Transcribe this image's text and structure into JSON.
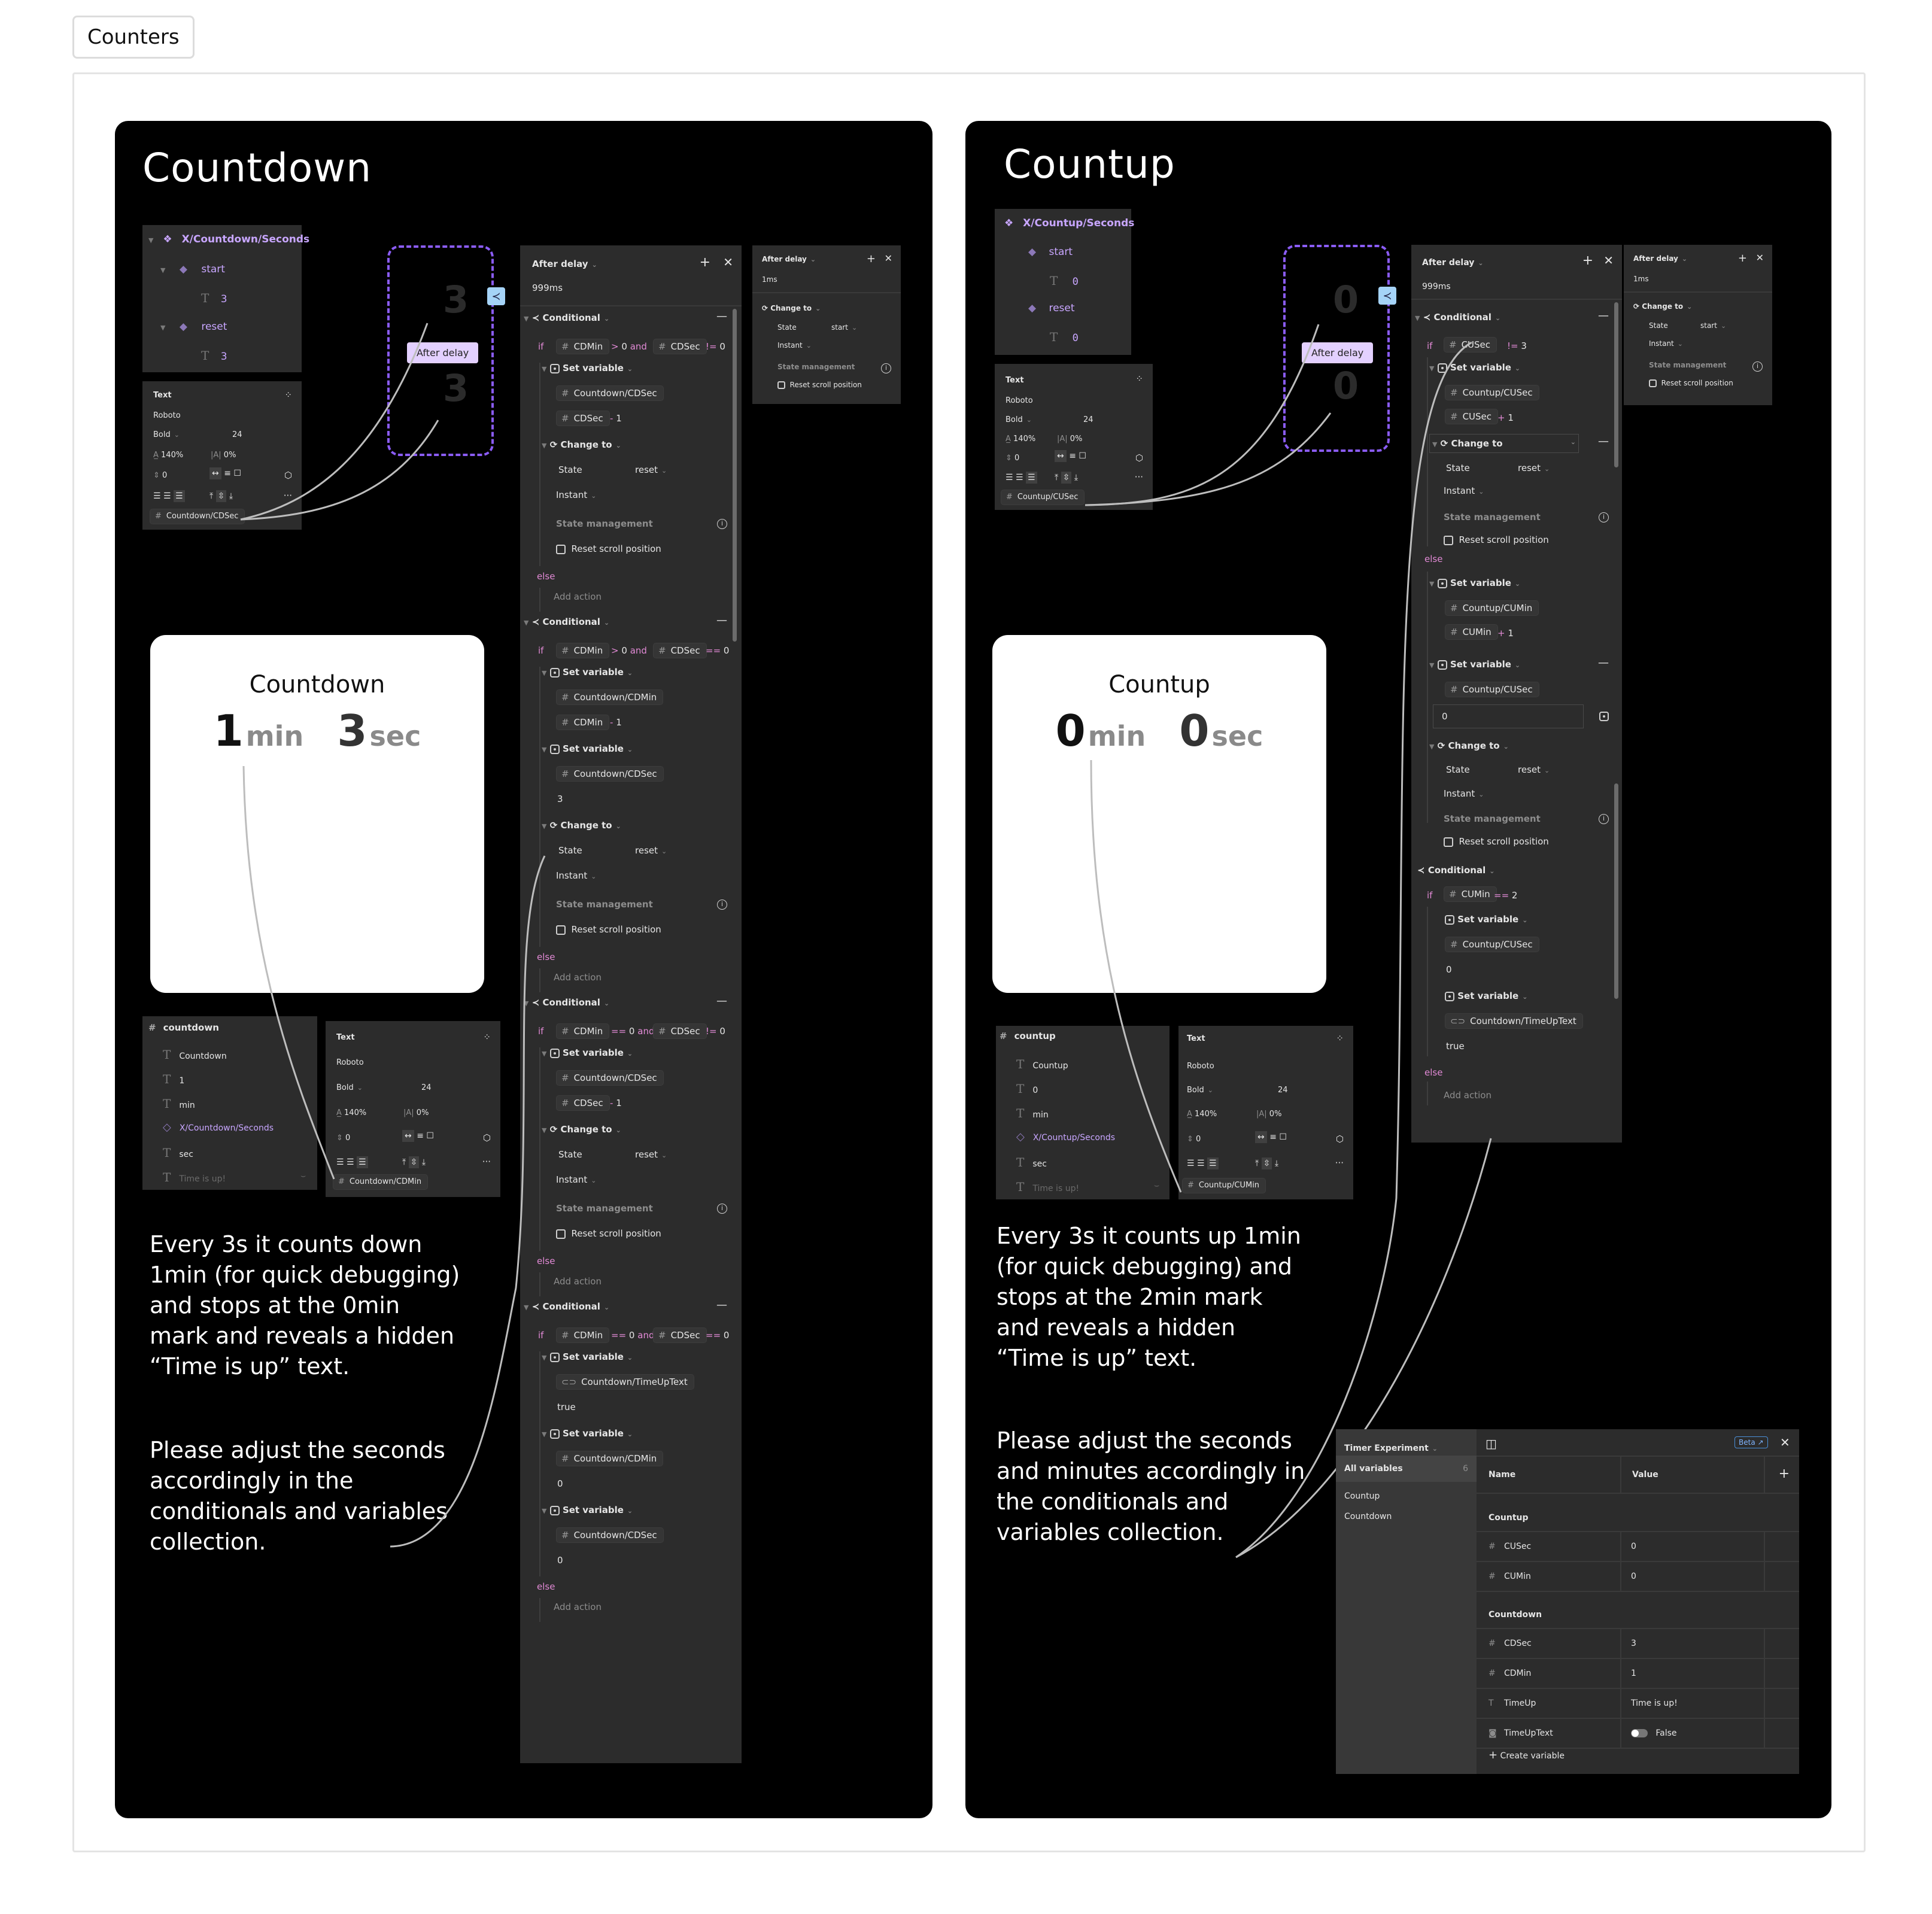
{
  "page_tab": "Counters",
  "countdown": {
    "title": "Countdown",
    "component_tree": {
      "name": "X/Countdown/Seconds",
      "variants": [
        {
          "name": "start",
          "text": "3"
        },
        {
          "name": "reset",
          "text": "3"
        }
      ]
    },
    "text_panel": {
      "title": "Text",
      "font": "Roboto",
      "weight": "Bold",
      "size": "24",
      "line_height": "140%",
      "letter_spacing": "0%",
      "paragraph_spacing": "0",
      "bound_variable": "Countdown/CDSec"
    },
    "variant_preview": {
      "top_num": "3",
      "bottom_num": "3",
      "trigger_label": "After delay"
    },
    "main_interaction": {
      "trigger": "After delay",
      "delay": "999ms",
      "conditionals": [
        {
          "label": "Conditional",
          "if": {
            "left_var": "CDMin",
            "left_op": ">",
            "left_val": "0",
            "join": "and",
            "right_var": "CDSec",
            "right_op": "!=",
            "right_val": "0"
          },
          "actions": [
            {
              "type": "Set variable",
              "target": "Countdown/CDSec",
              "expr_var": "CDSec",
              "expr_op": "-",
              "expr_val": "1"
            },
            {
              "type": "Change to",
              "state_label": "State",
              "state": "reset",
              "transition": "Instant",
              "state_mgmt": "State management",
              "reset_scroll": "Reset scroll position"
            }
          ],
          "else_label": "else",
          "else_action": "Add action"
        },
        {
          "label": "Conditional",
          "if": {
            "left_var": "CDMin",
            "left_op": ">",
            "left_val": "0",
            "join": "and",
            "right_var": "CDSec",
            "right_op": "==",
            "right_val": "0"
          },
          "actions": [
            {
              "type": "Set variable",
              "target": "Countdown/CDMin",
              "expr_var": "CDMin",
              "expr_op": "-",
              "expr_val": "1"
            },
            {
              "type": "Set variable",
              "target": "Countdown/CDSec",
              "value": "3"
            },
            {
              "type": "Change to",
              "state_label": "State",
              "state": "reset",
              "transition": "Instant",
              "state_mgmt": "State management",
              "reset_scroll": "Reset scroll position"
            }
          ],
          "else_label": "else",
          "else_action": "Add action"
        },
        {
          "label": "Conditional",
          "if": {
            "left_var": "CDMin",
            "left_op": "==",
            "left_val": "0",
            "join": "and",
            "right_var": "CDSec",
            "right_op": "!=",
            "right_val": "0"
          },
          "actions": [
            {
              "type": "Set variable",
              "target": "Countdown/CDSec",
              "expr_var": "CDSec",
              "expr_op": "-",
              "expr_val": "1"
            },
            {
              "type": "Change to",
              "state_label": "State",
              "state": "reset",
              "transition": "Instant",
              "state_mgmt": "State management",
              "reset_scroll": "Reset scroll position"
            }
          ],
          "else_label": "else",
          "else_action": "Add action"
        },
        {
          "label": "Conditional",
          "if": {
            "left_var": "CDMin",
            "left_op": "==",
            "left_val": "0",
            "join": "and",
            "right_var": "CDSec",
            "right_op": "==",
            "right_val": "0"
          },
          "actions": [
            {
              "type": "Set variable",
              "target": "Countdown/TimeUpText",
              "value": "true"
            },
            {
              "type": "Set variable",
              "target": "Countdown/CDMin",
              "value": "0"
            },
            {
              "type": "Set variable",
              "target": "Countdown/CDSec",
              "value": "0"
            }
          ],
          "else_label": "else",
          "else_action": "Add action"
        }
      ]
    },
    "reset_interaction": {
      "trigger": "After delay",
      "delay": "1ms",
      "action": "Change to",
      "state_label": "State",
      "state": "start",
      "transition": "Instant",
      "state_mgmt": "State management",
      "reset_scroll": "Reset scroll position"
    },
    "preview": {
      "title": "Countdown",
      "min_value": "1",
      "min_unit": "min",
      "sec_value": "3",
      "sec_unit": "sec"
    },
    "layers": {
      "frame": "countdown",
      "items": [
        {
          "icon": "text",
          "label": "Countdown"
        },
        {
          "icon": "text",
          "label": "1"
        },
        {
          "icon": "text",
          "label": "min"
        },
        {
          "icon": "instance",
          "label": "X/Countdown/Seconds"
        },
        {
          "icon": "text",
          "label": "sec"
        },
        {
          "icon": "text",
          "label": "Time is up!",
          "hidden": true
        }
      ]
    },
    "text_panel_2": {
      "title": "Text",
      "font": "Roboto",
      "weight": "Bold",
      "size": "24",
      "line_height": "140%",
      "letter_spacing": "0%",
      "paragraph_spacing": "0",
      "bound_variable": "Countdown/CDMin"
    },
    "description": [
      "Every 3s it counts down 1min (for quick debugging) and stops at the 0min mark and reveals a hidden “Time is up” text.",
      "Please adjust the seconds accordingly in the conditionals and variables collection."
    ]
  },
  "countup": {
    "title": "Countup",
    "component_tree": {
      "name": "X/Countup/Seconds",
      "variants": [
        {
          "name": "start",
          "text": "0"
        },
        {
          "name": "reset",
          "text": "0"
        }
      ]
    },
    "text_panel": {
      "title": "Text",
      "font": "Roboto",
      "weight": "Bold",
      "size": "24",
      "line_height": "140%",
      "letter_spacing": "0%",
      "paragraph_spacing": "0",
      "bound_variable": "Countup/CUSec"
    },
    "variant_preview": {
      "top_num": "0",
      "bottom_num": "0",
      "trigger_label": "After delay"
    },
    "main_interaction": {
      "trigger": "After delay",
      "delay": "999ms",
      "cond1": {
        "label": "Conditional",
        "if_var": "CUSec",
        "if_op": "!=",
        "if_val": "3",
        "set1": {
          "type": "Set variable",
          "target": "Countup/CUSec",
          "expr_var": "CUSec",
          "expr_op": "+",
          "expr_val": "1"
        },
        "change": {
          "type": "Change to",
          "state_label": "State",
          "state": "reset",
          "transition": "Instant",
          "state_mgmt": "State management",
          "reset_scroll": "Reset scroll position"
        },
        "else_label": "else",
        "else_set1": {
          "type": "Set variable",
          "target": "Countup/CUMin",
          "expr_var": "CUMin",
          "expr_op": "+",
          "expr_val": "1"
        },
        "else_set2": {
          "type": "Set variable",
          "target": "Countup/CUSec",
          "value": "0"
        },
        "else_change": {
          "type": "Change to",
          "state_label": "State",
          "state": "reset",
          "transition": "Instant",
          "state_mgmt": "State management",
          "reset_scroll": "Reset scroll position"
        }
      },
      "cond2": {
        "label": "Conditional",
        "if_var": "CUMin",
        "if_op": "==",
        "if_val": "2",
        "set1": {
          "type": "Set variable",
          "target": "Countup/CUSec",
          "value": "0"
        },
        "set2": {
          "type": "Set variable",
          "target": "Countdown/TimeUpText",
          "value": "true"
        },
        "else_label": "else",
        "else_action": "Add action"
      }
    },
    "reset_interaction": {
      "trigger": "After delay",
      "delay": "1ms",
      "action": "Change to",
      "state_label": "State",
      "state": "start",
      "transition": "Instant",
      "state_mgmt": "State management",
      "reset_scroll": "Reset scroll position"
    },
    "preview": {
      "title": "Countup",
      "min_value": "0",
      "min_unit": "min",
      "sec_value": "0",
      "sec_unit": "sec"
    },
    "layers": {
      "frame": "countup",
      "items": [
        {
          "icon": "text",
          "label": "Countup"
        },
        {
          "icon": "text",
          "label": "0"
        },
        {
          "icon": "text",
          "label": "min"
        },
        {
          "icon": "instance",
          "label": "X/Countup/Seconds"
        },
        {
          "icon": "text",
          "label": "sec"
        },
        {
          "icon": "text",
          "label": "Time is up!",
          "hidden": true
        }
      ]
    },
    "text_panel_2": {
      "title": "Text",
      "font": "Roboto",
      "weight": "Bold",
      "size": "24",
      "line_height": "140%",
      "letter_spacing": "0%",
      "paragraph_spacing": "0",
      "bound_variable": "Countup/CUMin"
    },
    "description": [
      "Every 3s it counts up 1min (for quick debugging) and stops at the 2min mark and reveals a hidden “Time is up” text.",
      "Please adjust the seconds and minutes accordingly in the conditionals and variables collection."
    ]
  },
  "variables_modal": {
    "collection": "Timer Experiment",
    "beta_label": "Beta",
    "sidebar": [
      {
        "label": "All variables",
        "count": "6",
        "selected": true
      },
      {
        "label": "Countup"
      },
      {
        "label": "Countdown"
      }
    ],
    "columns": [
      "Name",
      "Value"
    ],
    "groups": [
      {
        "name": "Countup",
        "rows": [
          {
            "type": "number",
            "name": "CUSec",
            "value": "0"
          },
          {
            "type": "number",
            "name": "CUMin",
            "value": "0"
          }
        ]
      },
      {
        "name": "Countdown",
        "rows": [
          {
            "type": "number",
            "name": "CDSec",
            "value": "3"
          },
          {
            "type": "number",
            "name": "CDMin",
            "value": "1"
          },
          {
            "type": "string",
            "name": "TimeUp",
            "value": "Time is up!"
          },
          {
            "type": "boolean",
            "name": "TimeUpText",
            "value": "False"
          }
        ]
      }
    ],
    "create_label": "Create variable"
  },
  "colors": {
    "canvas_bg": "#000000",
    "panel_bg": "#2c2c2c",
    "component_purple": "#c8a6ff",
    "variant_border": "#8b5cf6",
    "keyword_pink": "#e28ad6",
    "trigger_tag": "#e3d0ff",
    "conditional_badge": "#a5d3f7"
  }
}
